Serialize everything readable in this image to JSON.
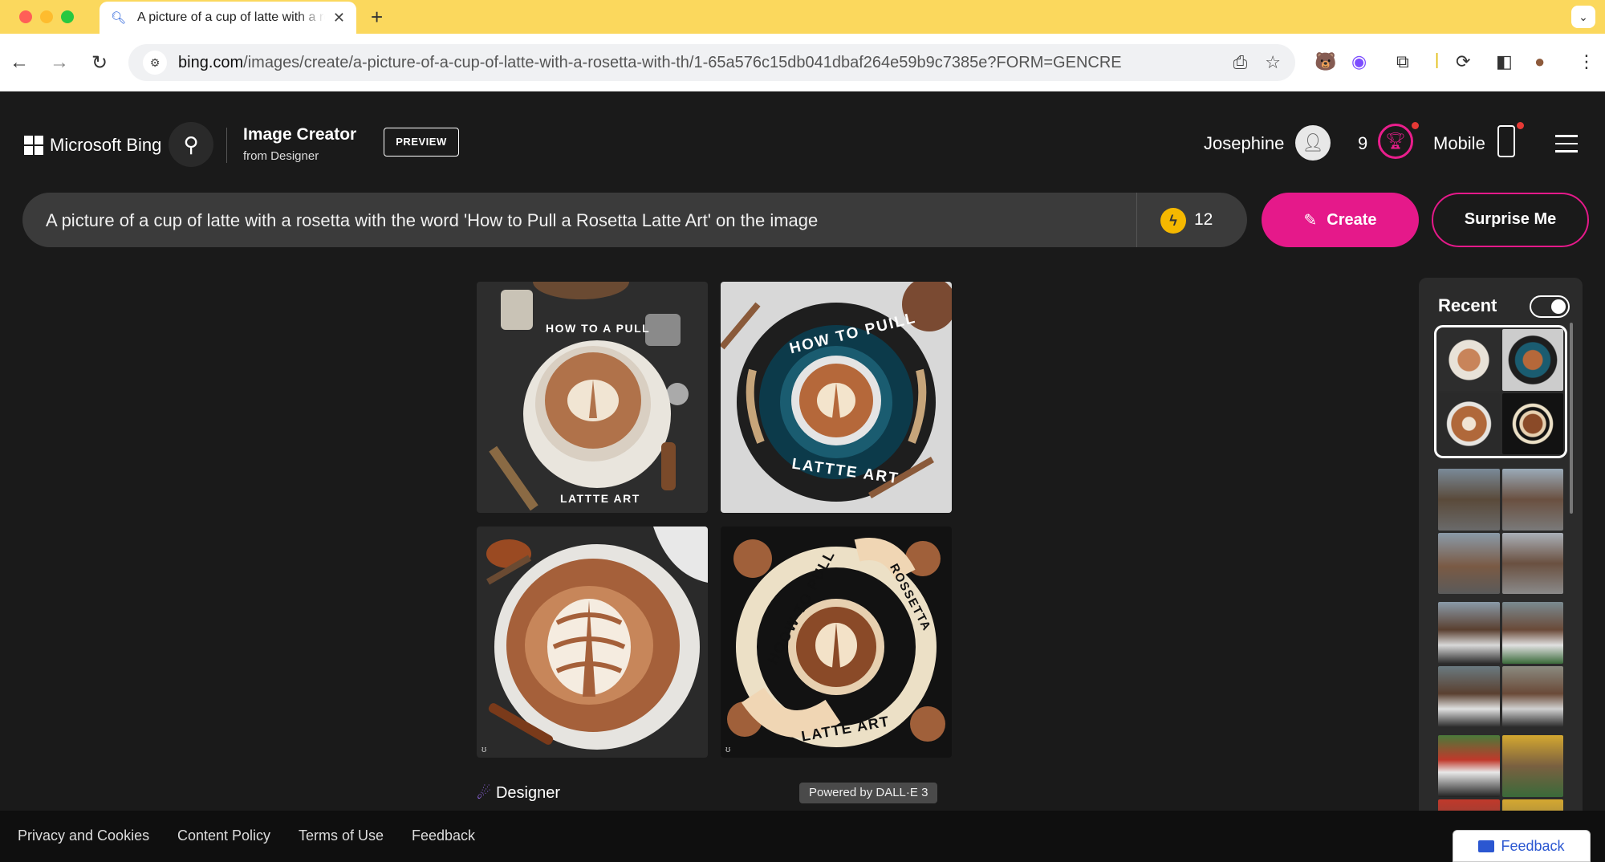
{
  "browser": {
    "tab_title": "A picture of a cup of latte with a rosetta",
    "url_host": "bing.com",
    "url_path": "/images/create/a-picture-of-a-cup-of-latte-with-a-rosetta-with-th/1-65a576c15db041dbaf264e59b9c7385e?FORM=GENCRE"
  },
  "header": {
    "logo_text": "Microsoft Bing",
    "product_title": "Image Creator",
    "product_sub": "from Designer",
    "preview_label": "PREVIEW",
    "user_name": "Josephine",
    "reward_count": "9",
    "mobile_label": "Mobile"
  },
  "prompt": {
    "text": "A picture of a cup of latte with a rosetta with the word 'How to Pull a Rosetta Latte Art' on the image",
    "boosts": "12",
    "create_label": "Create",
    "surprise_label": "Surprise Me"
  },
  "images": [
    {
      "top_text": "HOW TO A PULL",
      "bottom_text": "LATTTE ART"
    },
    {
      "top_text": "HOW TO PUILL",
      "bottom_text": "LATTTE ART"
    },
    {
      "top_text": "",
      "bottom_text": ""
    },
    {
      "top_text": "HOOW TO PULL",
      "side_text": "ROSSETTA",
      "bottom_text": "LATTE ART"
    }
  ],
  "branding": {
    "designer_label": "Designer",
    "dalle_label": "Powered by DALL·E 3"
  },
  "recent": {
    "title": "Recent"
  },
  "footer": {
    "links": [
      "Privacy and Cookies",
      "Content Policy",
      "Terms of Use",
      "Feedback"
    ],
    "feedback_button": "Feedback"
  },
  "colors": {
    "accent_pink": "#e5198a",
    "boost_yellow": "#f5b800",
    "tabbar_yellow": "#fbd85d"
  }
}
